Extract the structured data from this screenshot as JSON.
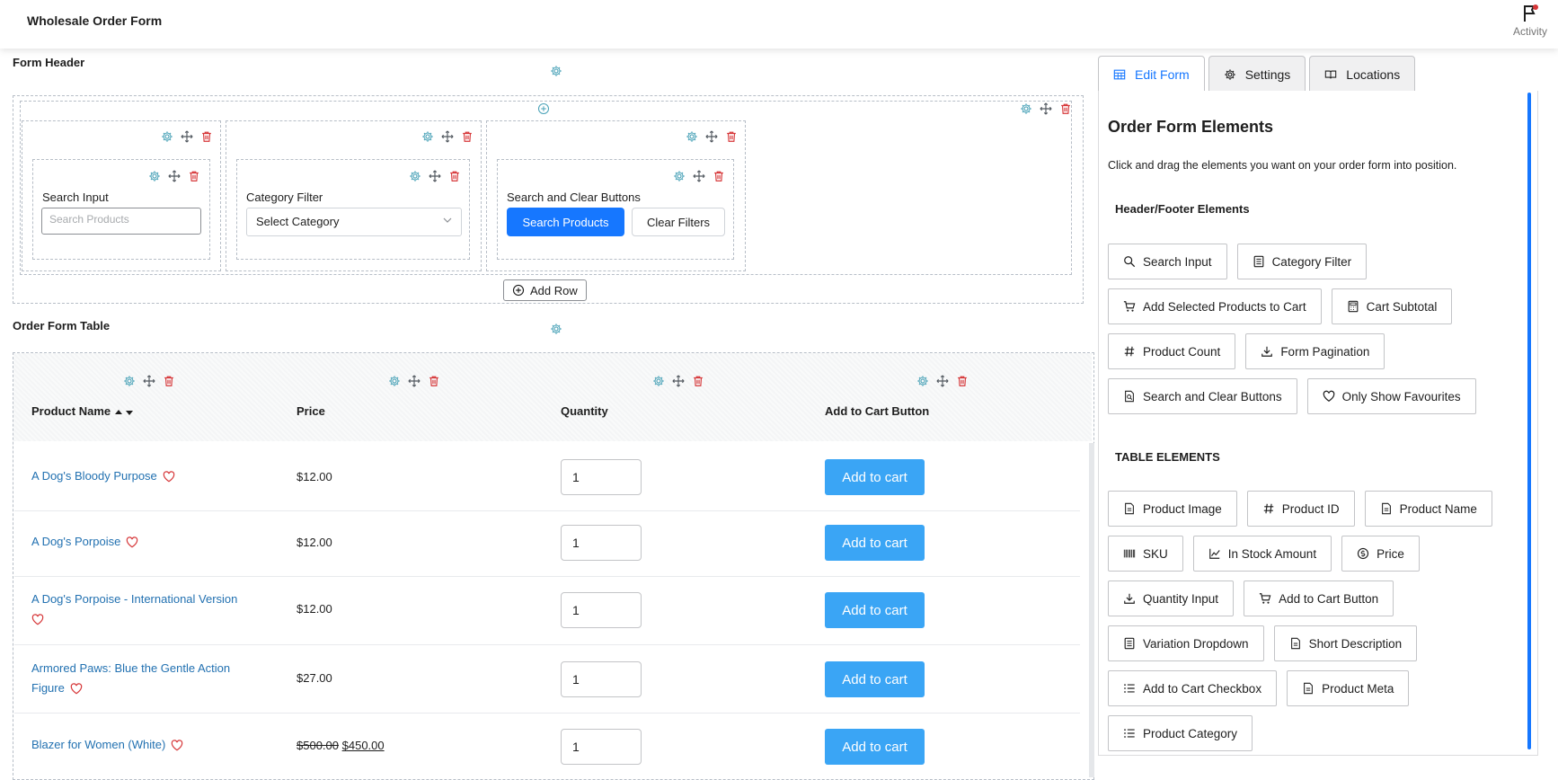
{
  "app": {
    "title": "Wholesale Order Form",
    "activity_label": "Activity"
  },
  "form_header": {
    "label": "Form Header",
    "search_input": {
      "label": "Search Input",
      "placeholder": "Search Products"
    },
    "category_filter": {
      "label": "Category Filter",
      "value": "Select Category"
    },
    "search_clear": {
      "label": "Search and Clear Buttons",
      "search_label": "Search Products",
      "clear_label": "Clear Filters"
    },
    "add_row_label": "Add Row"
  },
  "order_table": {
    "label": "Order Form Table",
    "columns": [
      "Product Name",
      "Price",
      "Quantity",
      "Add to Cart Button"
    ],
    "rows": [
      {
        "name": "A Dog's Bloody Purpose",
        "price": "$12.00",
        "qty": "1",
        "cart_label": "Add to cart"
      },
      {
        "name": "A Dog's Porpoise",
        "price": "$12.00",
        "qty": "1",
        "cart_label": "Add to cart"
      },
      {
        "name": "A Dog's Porpoise - International Version",
        "price": "$12.00",
        "qty": "1",
        "cart_label": "Add to cart"
      },
      {
        "name": "Armored Paws: Blue the Gentle Action Figure",
        "price": "$27.00",
        "qty": "1",
        "cart_label": "Add to cart"
      },
      {
        "name": "Blazer for Women (White)",
        "price_old": "$500.00",
        "price_new": "$450.00",
        "qty": "1",
        "cart_label": "Add to cart"
      }
    ]
  },
  "tabs": [
    {
      "label": "Edit Form",
      "icon": "table-icon",
      "active": true
    },
    {
      "label": "Settings",
      "icon": "gear-icon",
      "active": false
    },
    {
      "label": "Locations",
      "icon": "book-icon",
      "active": false
    }
  ],
  "panel": {
    "title": "Order Form Elements",
    "description": "Click and drag the elements you want on your order form into position.",
    "header_footer_title": "Header/Footer Elements",
    "header_footer_items": [
      "Search Input",
      "Category Filter",
      "Add Selected Products to Cart",
      "Cart Subtotal",
      "Product Count",
      "Form Pagination",
      "Search and Clear Buttons",
      "Only Show Favourites"
    ],
    "table_title": "TABLE ELEMENTS",
    "table_items": [
      "Product Image",
      "Product ID",
      "Product Name",
      "SKU",
      "In Stock Amount",
      "Price",
      "Quantity Input",
      "Add to Cart Button",
      "Variation Dropdown",
      "Short Description",
      "Add to Cart Checkbox",
      "Product Meta",
      "Product Category"
    ]
  },
  "colors": {
    "primary": "#1677ff",
    "cart_button": "#3aa5f5",
    "link": "#2271b1",
    "delete": "#d63638",
    "gear": "#4ba3b8"
  }
}
